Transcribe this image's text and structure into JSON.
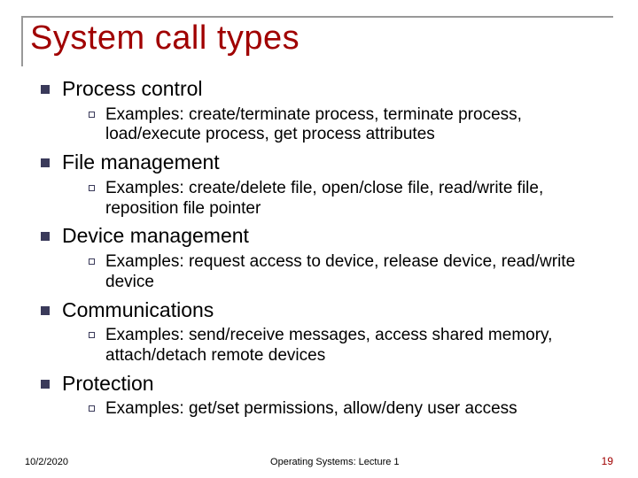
{
  "title": "System call types",
  "items": [
    {
      "label": "Process control",
      "sub": "Examples: create/terminate process, terminate process, load/execute process, get process attributes"
    },
    {
      "label": "File management",
      "sub": "Examples: create/delete file, open/close file, read/write file, reposition file pointer"
    },
    {
      "label": "Device management",
      "sub": "Examples: request access to device, release device, read/write device"
    },
    {
      "label": "Communications",
      "sub": "Examples: send/receive messages, access shared memory, attach/detach remote devices"
    },
    {
      "label": "Protection",
      "sub": "Examples: get/set permissions, allow/deny user access"
    }
  ],
  "footer": {
    "date": "10/2/2020",
    "center": "Operating Systems: Lecture 1",
    "page": "19"
  }
}
